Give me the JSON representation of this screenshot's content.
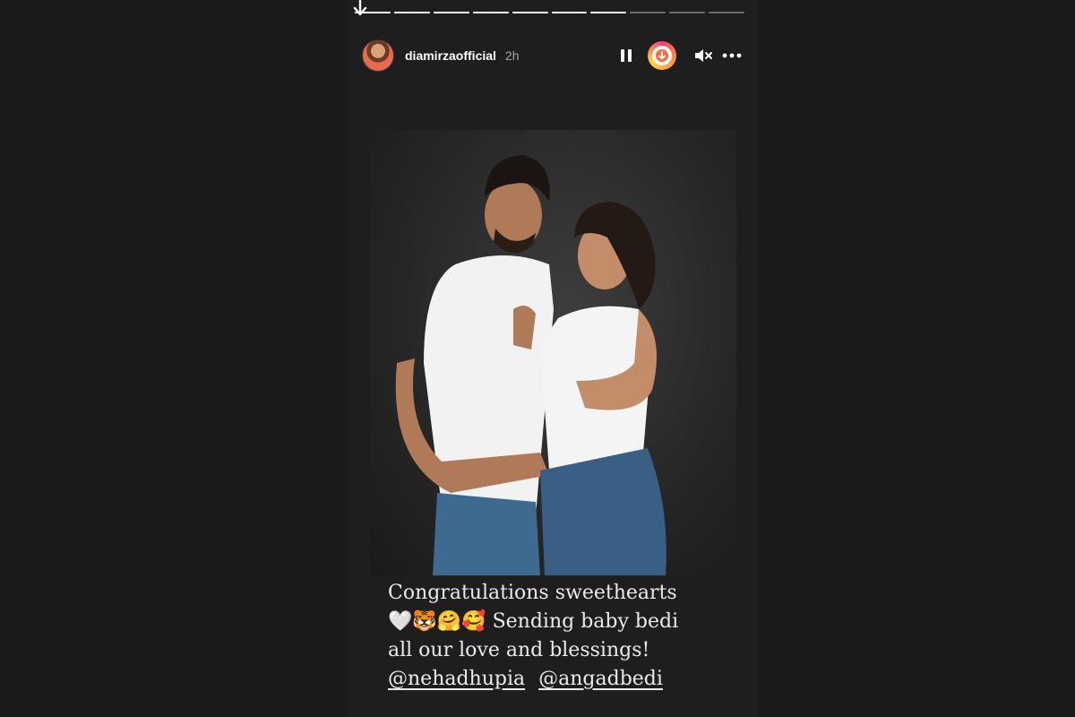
{
  "story": {
    "progress": {
      "total_segments": 10,
      "completed_segments": 7
    },
    "header": {
      "username": "diamirzaofficial",
      "time": "2h",
      "pause_icon": "pause-icon",
      "download_icon": "download-icon",
      "mute_icon": "mute-icon",
      "more_icon": "more-icon"
    },
    "caption": {
      "line1": "Congratulations sweethearts",
      "line2_emojis": "🤍🐯🤗🥰",
      "line2_text": " Sending baby bedi",
      "line3": "all our love and blessings!",
      "mention1": "@nehadhupia",
      "mention2": "@angadbedi"
    }
  }
}
